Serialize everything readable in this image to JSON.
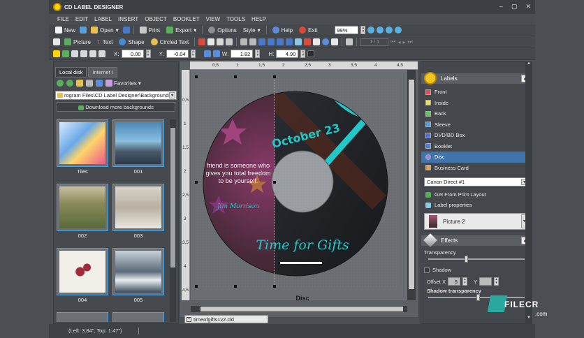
{
  "app": {
    "title": "CD LABEL DESIGNER",
    "window_controls": [
      "–",
      "▢",
      "✕"
    ]
  },
  "menu": [
    "FILE",
    "EDIT",
    "LABEL",
    "INSERT",
    "OBJECT",
    "BOOKLET",
    "VIEW",
    "TOOLS",
    "HELP"
  ],
  "toolbar1": {
    "new": "New",
    "open": "Open",
    "print": "Print",
    "export": "Export",
    "options": "Options",
    "style": "Style",
    "help": "Help",
    "exit": "Exit",
    "zoom": "99%"
  },
  "toolbar2": {
    "picture": "Picture",
    "text": "Text",
    "shape": "Shape",
    "circled_text": "Circled Text",
    "page_counter": "1 / 1"
  },
  "toolbar3": {
    "x_label": "X:",
    "x_value": "0.00",
    "y_label": "Y:",
    "y_value": "-0.04",
    "w_label": "W:",
    "w_value": "1.82",
    "h_label": "H:",
    "h_value": "4.90"
  },
  "left_panel": {
    "tabs": [
      "Local disk",
      "Internet I"
    ],
    "favorites": "Favorites",
    "path": "rogram Files\\CD Label Designer\\Backgrounds",
    "download": "Download more backgrounds",
    "thumbnails": [
      {
        "label": "Tiles"
      },
      {
        "label": "001"
      },
      {
        "label": "002"
      },
      {
        "label": "003"
      },
      {
        "label": "004"
      },
      {
        "label": "005"
      }
    ]
  },
  "canvas": {
    "ruler_h": [
      "0,5",
      "1",
      "1,5",
      "2",
      "2,5",
      "3",
      "3,5",
      "4",
      "4,5"
    ],
    "ruler_v": [
      "0,5",
      "1",
      "1,5",
      "2",
      "2,5",
      "3",
      "3,5",
      "4",
      "4,5"
    ],
    "disc_label": "Disc",
    "date_text": "October 23",
    "quote": "friend is someone who gives you total freedom to be yourself.",
    "author": "Jim Morrison",
    "headline": "Time for Gifts",
    "doc_tab": "timeofgifts1v2.cld"
  },
  "right_panel": {
    "labels_title": "Labels",
    "labels": [
      {
        "name": "Front",
        "color": "#e05050"
      },
      {
        "name": "Inside",
        "color": "#f0e050"
      },
      {
        "name": "Back",
        "color": "#5ac85a"
      },
      {
        "name": "Sleeve",
        "color": "#4aa3e0"
      },
      {
        "name": "DVD/BD Box",
        "color": "#4a6ee0"
      },
      {
        "name": "Booklet",
        "color": "#5080d8"
      },
      {
        "name": "Disc",
        "color": "#a080e0"
      },
      {
        "name": "Business Card",
        "color": "#e0a050"
      }
    ],
    "selected_label": "Disc",
    "printer_layout": "Canon Direct #1",
    "get_layout": "Get From Print Layout",
    "label_properties": "Label properties",
    "picture_select": "Picture 2",
    "effects_title": "Effects",
    "transparency_label": "Transparency",
    "transparency": 0.38,
    "shadow_label": "Shadow",
    "offset_x_label": "Offset X",
    "offset_x": "5",
    "offset_y_label": "Y",
    "shadow_transparency_label": "Shadow transparency",
    "shadow_transparency": 0.5
  },
  "status": {
    "position": "(Left: 3.84\", Top: 1.47\")"
  },
  "watermark": "FILECR",
  "watermark_sub": ".com"
}
